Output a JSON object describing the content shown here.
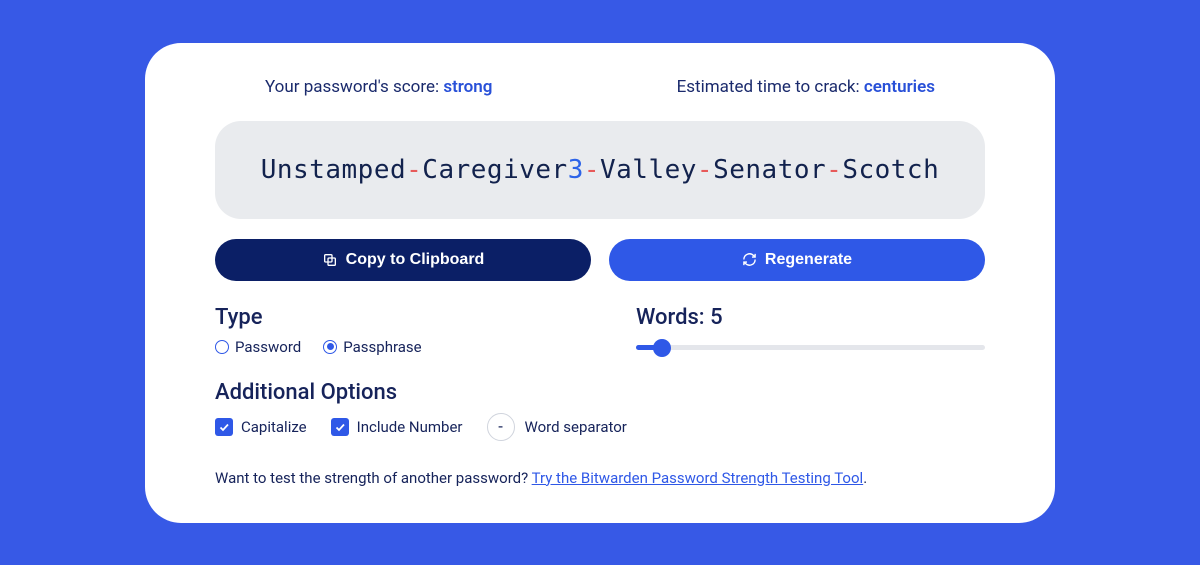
{
  "score": {
    "label": "Your password's score: ",
    "value": "strong"
  },
  "crack": {
    "label": "Estimated time to crack: ",
    "value": "centuries"
  },
  "passphrase": {
    "words": [
      "Unstamped",
      "Caregiver",
      "Valley",
      "Senator",
      "Scotch"
    ],
    "number_after_word_index": 1,
    "number": "3",
    "separator": "-"
  },
  "buttons": {
    "copy": "Copy to Clipboard",
    "regenerate": "Regenerate"
  },
  "type_section": {
    "title": "Type",
    "options": {
      "password": "Password",
      "passphrase": "Passphrase"
    },
    "selected": "passphrase"
  },
  "words": {
    "label_prefix": "Words: ",
    "value": "5"
  },
  "additional": {
    "title": "Additional Options",
    "capitalize": "Capitalize",
    "include_number": "Include Number",
    "separator_label": "Word separator",
    "separator_value": "-"
  },
  "footer": {
    "text": "Want to test the strength of another password? ",
    "link": "Try the Bitwarden Password Strength Testing Tool",
    "period": "."
  }
}
